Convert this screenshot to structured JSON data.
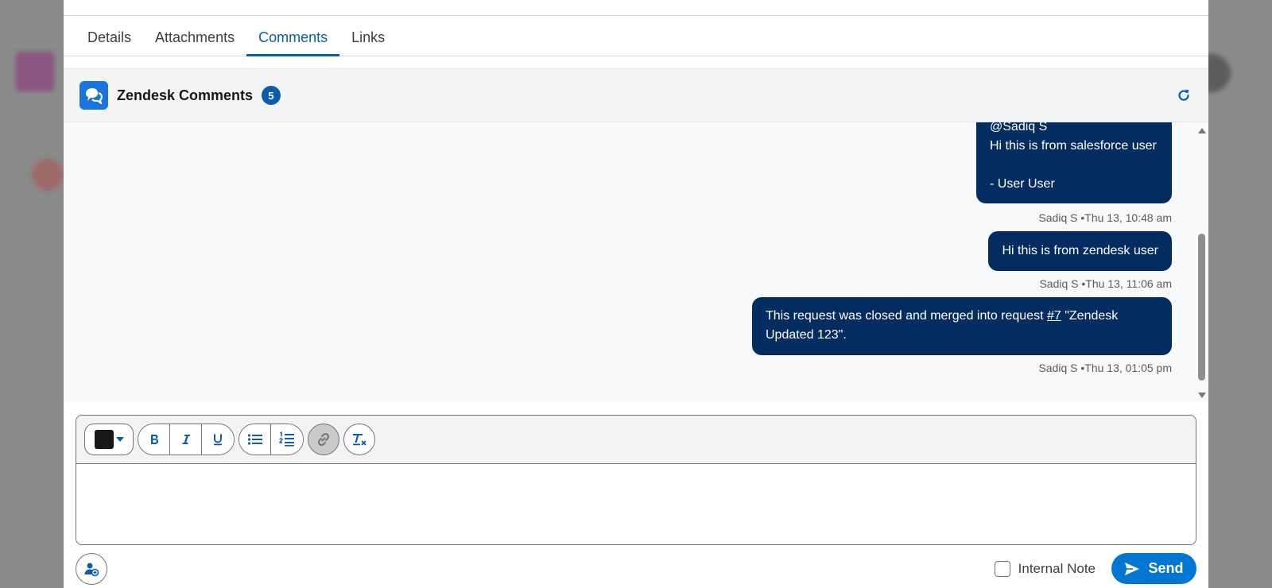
{
  "tabs": [
    {
      "label": "Details"
    },
    {
      "label": "Attachments"
    },
    {
      "label": "Comments"
    },
    {
      "label": "Links"
    }
  ],
  "header": {
    "title": "Zendesk Comments",
    "count": "5",
    "app_icon": "chat-bubbles-icon",
    "refresh_icon": "refresh-icon"
  },
  "comments": [
    {
      "text": "@Sadiq S\nHi this is from salesforce user\n\n- User User",
      "meta": "Sadiq S •Thu 13, 10:48 am"
    },
    {
      "text": "Hi this is from zendesk user",
      "meta": "Sadiq S •Thu 13, 11:06 am"
    },
    {
      "text_before": "This request was closed and merged into request ",
      "link": "#7",
      "text_after": " \"Zendesk Updated 123\".",
      "meta": "Sadiq S •Thu 13, 01:05 pm"
    }
  ],
  "toolbar": {
    "text_color": "#181818",
    "bold_icon": "bold-icon",
    "italic_icon": "italic-icon",
    "underline_icon": "underline-icon",
    "bullet_icon": "bullet-list-icon",
    "numbered_icon": "numbered-list-icon",
    "link_icon": "link-icon",
    "clear_icon": "clear-format-icon"
  },
  "footer": {
    "internal_note_label": "Internal Note",
    "send_label": "Send"
  },
  "colors": {
    "accent": "#0176d3",
    "bubble": "#032d60",
    "tab_active": "#0b5cab"
  }
}
